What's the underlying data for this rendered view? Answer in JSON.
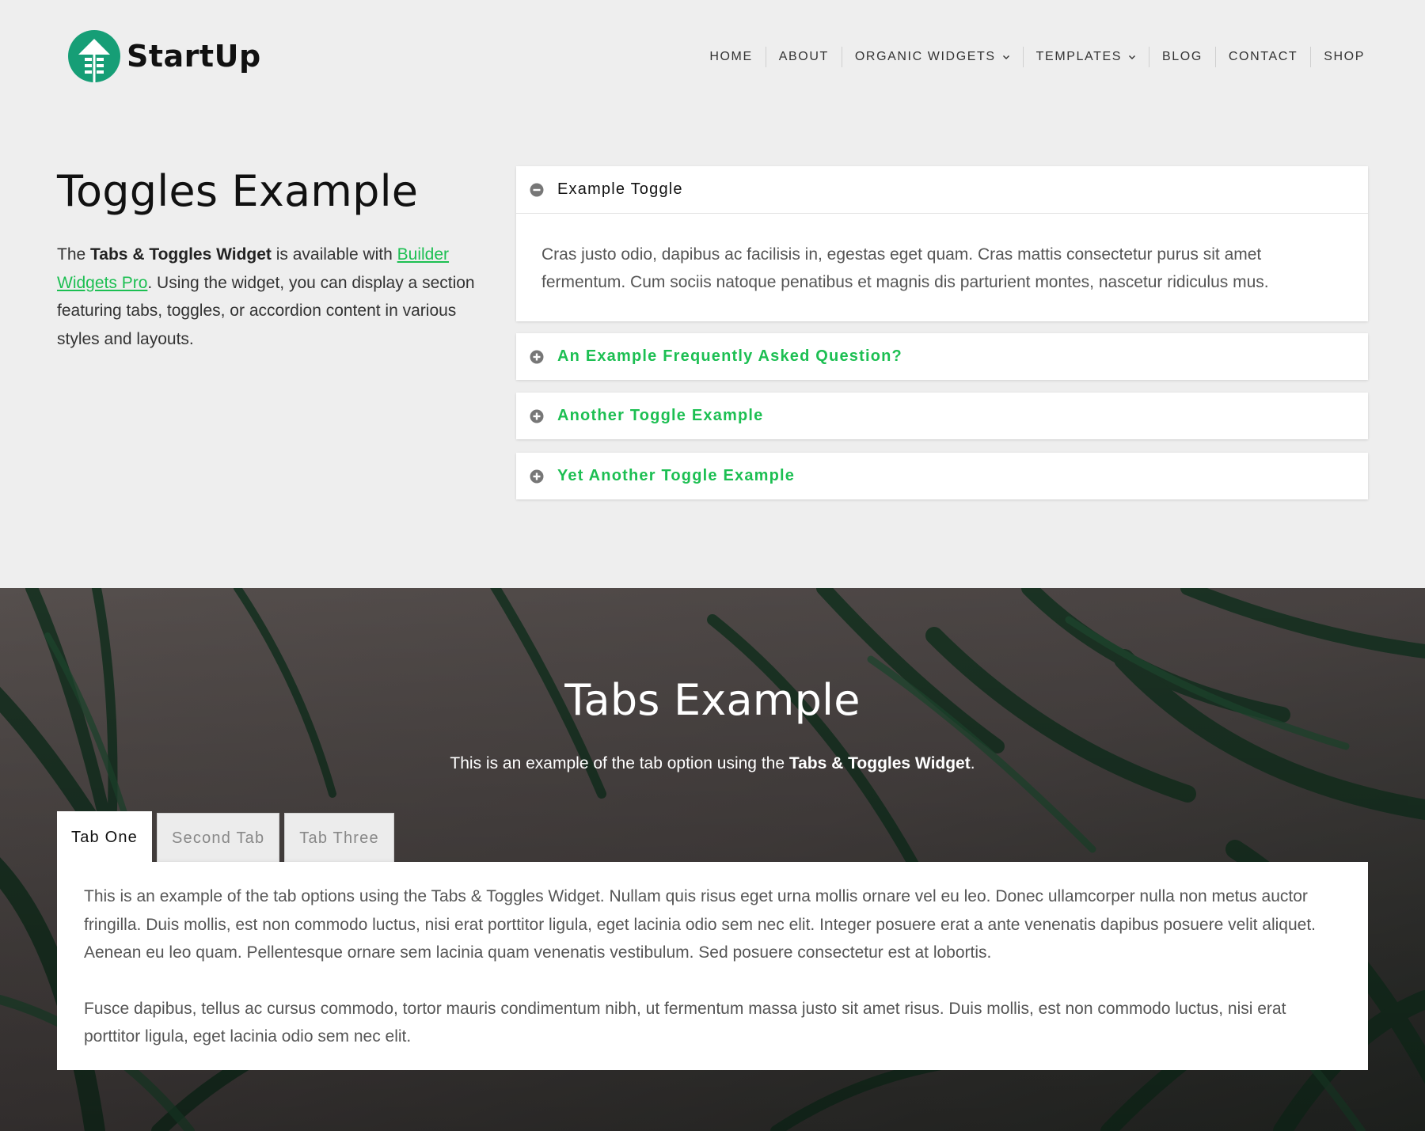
{
  "header": {
    "logo_text": "StartUp",
    "nav": [
      {
        "label": "HOME",
        "dropdown": false
      },
      {
        "label": "ABOUT",
        "dropdown": false
      },
      {
        "label": "ORGANIC WIDGETS",
        "dropdown": true
      },
      {
        "label": "TEMPLATES",
        "dropdown": true
      },
      {
        "label": "BLOG",
        "dropdown": false
      },
      {
        "label": "CONTACT",
        "dropdown": false
      },
      {
        "label": "SHOP",
        "dropdown": false
      }
    ]
  },
  "toggles_section": {
    "title": "Toggles Example",
    "intro": {
      "prefix": "The ",
      "bold": "Tabs & Toggles Widget",
      "middle": " is available with ",
      "link": "Builder Widgets Pro",
      "suffix": ". Using the widget, you can display a section featuring tabs, toggles, or accordion content in various styles and layouts."
    },
    "toggles": [
      {
        "label": "Example Toggle",
        "open": true,
        "icon": "minus-circle-icon",
        "body": "Cras justo odio, dapibus ac facilisis in, egestas eget quam. Cras mattis consectetur purus sit amet fermentum. Cum sociis natoque penatibus et magnis dis parturient montes, nascetur ridiculus mus."
      },
      {
        "label": "An Example Frequently Asked Question?",
        "open": false,
        "icon": "plus-circle-icon"
      },
      {
        "label": "Another Toggle Example",
        "open": false,
        "icon": "plus-circle-icon"
      },
      {
        "label": "Yet Another Toggle Example",
        "open": false,
        "icon": "plus-circle-icon"
      }
    ]
  },
  "tabs_section": {
    "title": "Tabs Example",
    "intro": {
      "prefix": "This is an example of the tab option using the ",
      "bold": "Tabs & Toggles Widget",
      "suffix": "."
    },
    "tabs": [
      {
        "label": "Tab One",
        "active": true
      },
      {
        "label": "Second Tab",
        "active": false
      },
      {
        "label": "Tab Three",
        "active": false
      }
    ],
    "panel": {
      "p1": "This is an example of the tab options using the Tabs & Toggles Widget. Nullam quis risus eget urna mollis ornare vel eu leo. Donec ullamcorper nulla non metus auctor fringilla. Duis mollis, est non commodo luctus, nisi erat porttitor ligula, eget lacinia odio sem nec elit. Integer posuere erat a ante venenatis dapibus posuere velit aliquet. Aenean eu leo quam. Pellentesque ornare sem lacinia quam venenatis vestibulum. Sed posuere consectetur est at lobortis.",
      "p2": "Fusce dapibus, tellus ac cursus commodo, tortor mauris condimentum nibh, ut fermentum massa justo sit amet risus. Duis mollis, est non commodo luctus, nisi erat porttitor ligula, eget lacinia odio sem nec elit."
    }
  },
  "colors": {
    "accent_green": "#1cbf52",
    "logo_green": "#169e76",
    "page_bg": "#eeeeee"
  }
}
